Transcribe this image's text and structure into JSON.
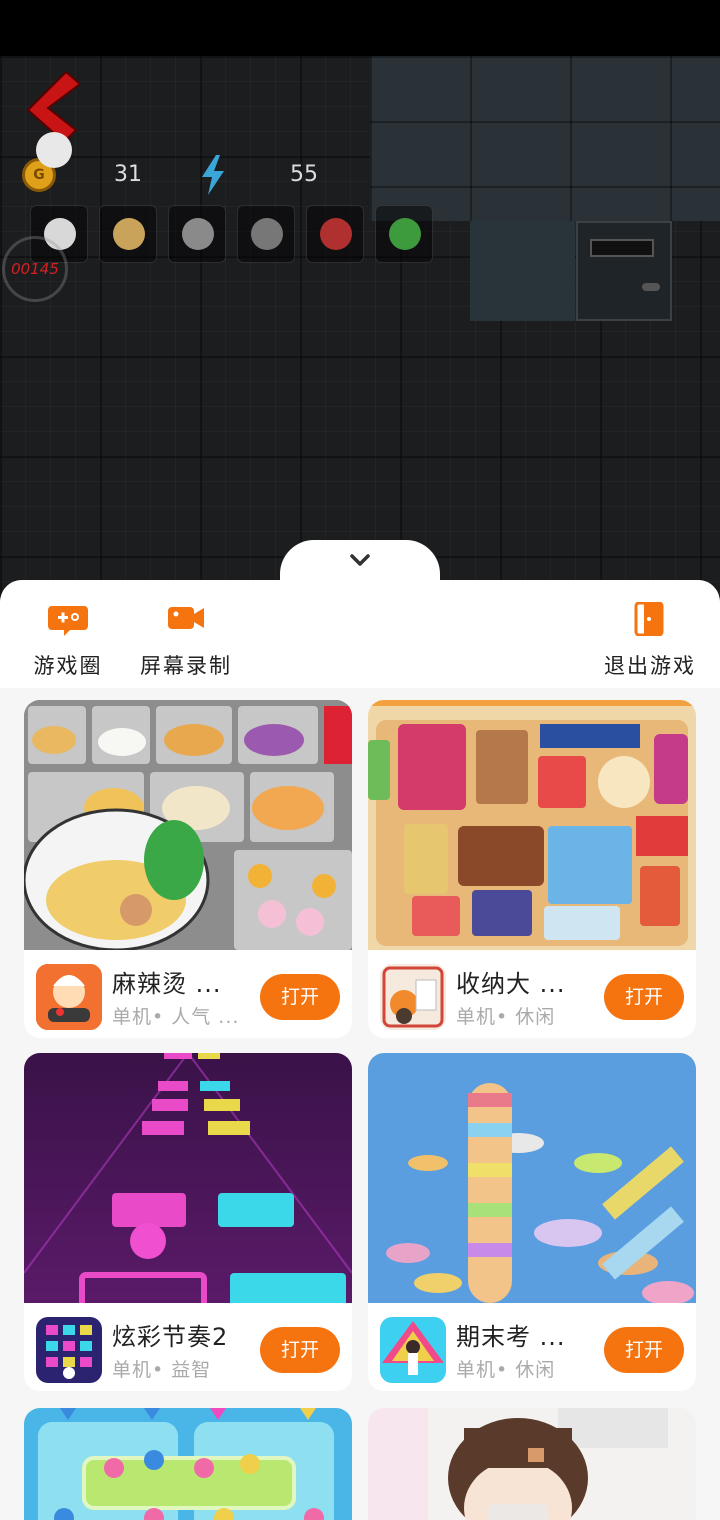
{
  "hud": {
    "coins": "31",
    "energy": "55",
    "timer": "00145",
    "coin_symbol": "G"
  },
  "toolbar": {
    "game_circle_label": "游戏圈",
    "screen_record_label": "屏幕录制",
    "exit_game_label": "退出游戏",
    "accent_color": "#f5740f"
  },
  "games": [
    {
      "title": "麻辣烫 ...",
      "tags": "单机• 人气 ...",
      "open_label": "打开"
    },
    {
      "title": "收纳大 ...",
      "tags": "单机• 休闲",
      "open_label": "打开"
    },
    {
      "title": "炫彩节奏2",
      "tags": "单机• 益智",
      "open_label": "打开"
    },
    {
      "title": "期末考 ...",
      "tags": "单机• 休闲",
      "open_label": "打开"
    }
  ]
}
